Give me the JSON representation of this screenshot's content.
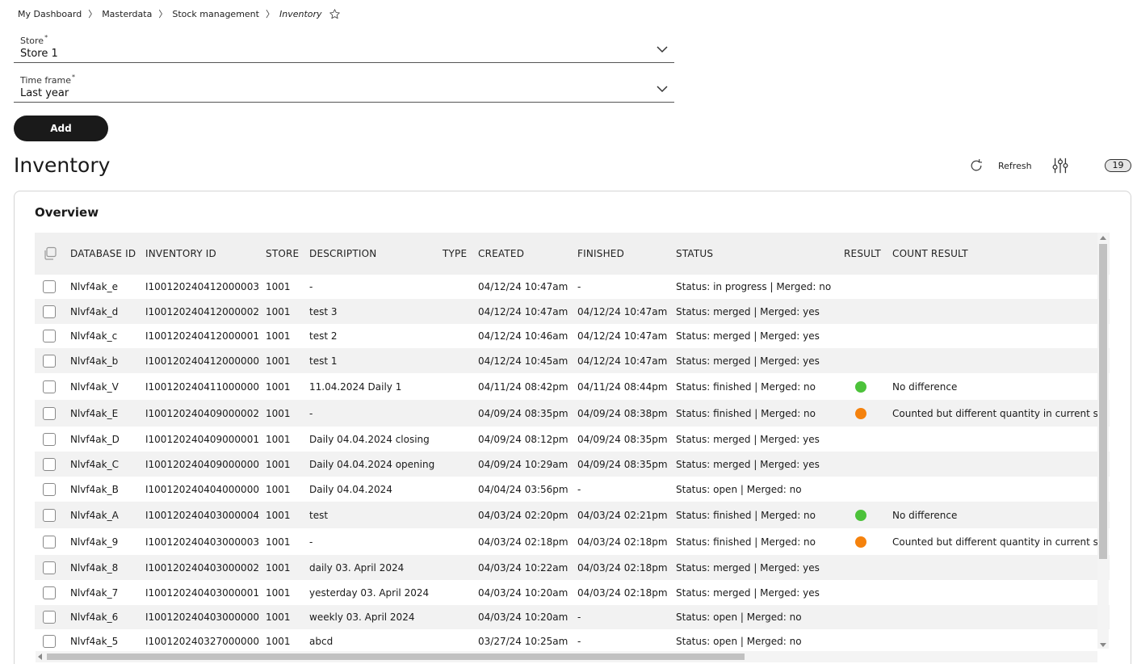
{
  "breadcrumb": {
    "items": [
      "My Dashboard",
      "Masterdata",
      "Stock management"
    ],
    "current": "Inventory",
    "separator": "〉"
  },
  "form": {
    "store": {
      "label": "Store",
      "required_mark": "*",
      "value": "Store 1"
    },
    "timeframe": {
      "label": "Time frame",
      "required_mark": "*",
      "value": "Last year"
    },
    "add_label": "Add"
  },
  "page": {
    "title": "Inventory",
    "refresh_label": "Refresh",
    "count": "19"
  },
  "panel": {
    "title": "Overview"
  },
  "table": {
    "columns": [
      "DATABASE ID",
      "INVENTORY ID",
      "STORE",
      "DESCRIPTION",
      "TYPE",
      "CREATED",
      "FINISHED",
      "STATUS",
      "RESULT",
      "COUNT RESULT"
    ],
    "rows": [
      {
        "db": "Nlvf4ak_e",
        "inv": "I100120240412000003",
        "store": "1001",
        "desc": "-",
        "type": "",
        "created": "04/12/24 10:47am",
        "finished": "-",
        "status": "Status: in progress | Merged: no",
        "result": "",
        "count": ""
      },
      {
        "db": "Nlvf4ak_d",
        "inv": "I100120240412000002",
        "store": "1001",
        "desc": "test 3",
        "type": "",
        "created": "04/12/24 10:47am",
        "finished": "04/12/24 10:47am",
        "status": "Status: merged | Merged: yes",
        "result": "",
        "count": ""
      },
      {
        "db": "Nlvf4ak_c",
        "inv": "I100120240412000001",
        "store": "1001",
        "desc": "test 2",
        "type": "",
        "created": "04/12/24 10:46am",
        "finished": "04/12/24 10:47am",
        "status": "Status: merged | Merged: yes",
        "result": "",
        "count": ""
      },
      {
        "db": "Nlvf4ak_b",
        "inv": "I100120240412000000",
        "store": "1001",
        "desc": "test 1",
        "type": "",
        "created": "04/12/24 10:45am",
        "finished": "04/12/24 10:47am",
        "status": "Status: merged | Merged: yes",
        "result": "",
        "count": ""
      },
      {
        "db": "Nlvf4ak_V",
        "inv": "I100120240411000000",
        "store": "1001",
        "desc": "11.04.2024 Daily 1",
        "type": "",
        "created": "04/11/24 08:42pm",
        "finished": "04/11/24 08:44pm",
        "status": "Status: finished | Merged: no",
        "result": "green",
        "count": "No difference"
      },
      {
        "db": "Nlvf4ak_E",
        "inv": "I100120240409000002",
        "store": "1001",
        "desc": "-",
        "type": "",
        "created": "04/09/24 08:35pm",
        "finished": "04/09/24 08:38pm",
        "status": "Status: finished | Merged: no",
        "result": "orange",
        "count": "Counted but different quantity in current s"
      },
      {
        "db": "Nlvf4ak_D",
        "inv": "I100120240409000001",
        "store": "1001",
        "desc": "Daily 04.04.2024 closing",
        "type": "",
        "created": "04/09/24 08:12pm",
        "finished": "04/09/24 08:35pm",
        "status": "Status: merged | Merged: yes",
        "result": "",
        "count": ""
      },
      {
        "db": "Nlvf4ak_C",
        "inv": "I100120240409000000",
        "store": "1001",
        "desc": "Daily 04.04.2024 opening",
        "type": "",
        "created": "04/09/24 10:29am",
        "finished": "04/09/24 08:35pm",
        "status": "Status: merged | Merged: yes",
        "result": "",
        "count": ""
      },
      {
        "db": "Nlvf4ak_B",
        "inv": "I100120240404000000",
        "store": "1001",
        "desc": "Daily 04.04.2024",
        "type": "",
        "created": "04/04/24 03:56pm",
        "finished": "-",
        "status": "Status: open | Merged: no",
        "result": "",
        "count": ""
      },
      {
        "db": "Nlvf4ak_A",
        "inv": "I100120240403000004",
        "store": "1001",
        "desc": "test",
        "type": "",
        "created": "04/03/24 02:20pm",
        "finished": "04/03/24 02:21pm",
        "status": "Status: finished | Merged: no",
        "result": "green",
        "count": "No difference"
      },
      {
        "db": "Nlvf4ak_9",
        "inv": "I100120240403000003",
        "store": "1001",
        "desc": "-",
        "type": "",
        "created": "04/03/24 02:18pm",
        "finished": "04/03/24 02:18pm",
        "status": "Status: finished | Merged: no",
        "result": "orange",
        "count": "Counted but different quantity in current s"
      },
      {
        "db": "Nlvf4ak_8",
        "inv": "I100120240403000002",
        "store": "1001",
        "desc": "daily 03. April 2024",
        "type": "",
        "created": "04/03/24 10:22am",
        "finished": "04/03/24 02:18pm",
        "status": "Status: merged | Merged: yes",
        "result": "",
        "count": ""
      },
      {
        "db": "Nlvf4ak_7",
        "inv": "I100120240403000001",
        "store": "1001",
        "desc": "yesterday 03. April 2024",
        "type": "",
        "created": "04/03/24 10:20am",
        "finished": "04/03/24 02:18pm",
        "status": "Status: merged | Merged: yes",
        "result": "",
        "count": ""
      },
      {
        "db": "Nlvf4ak_6",
        "inv": "I100120240403000000",
        "store": "1001",
        "desc": "weekly 03. April 2024",
        "type": "",
        "created": "04/03/24 10:20am",
        "finished": "-",
        "status": "Status: open | Merged: no",
        "result": "",
        "count": ""
      },
      {
        "db": "Nlvf4ak_5",
        "inv": "I100120240327000000",
        "store": "1001",
        "desc": "abcd",
        "type": "",
        "created": "03/27/24 10:25am",
        "finished": "-",
        "status": "Status: open | Merged: no",
        "result": "",
        "count": ""
      }
    ]
  },
  "colors": {
    "green": "#4cc23a",
    "orange": "#f5820d",
    "button_bg": "#1a1a1a"
  },
  "icons": {
    "favorite": "star-outline-icon",
    "dropdown": "chevron-down-icon",
    "refresh": "refresh-icon",
    "filter": "filter-sliders-icon",
    "select_all": "select-all-icon"
  }
}
